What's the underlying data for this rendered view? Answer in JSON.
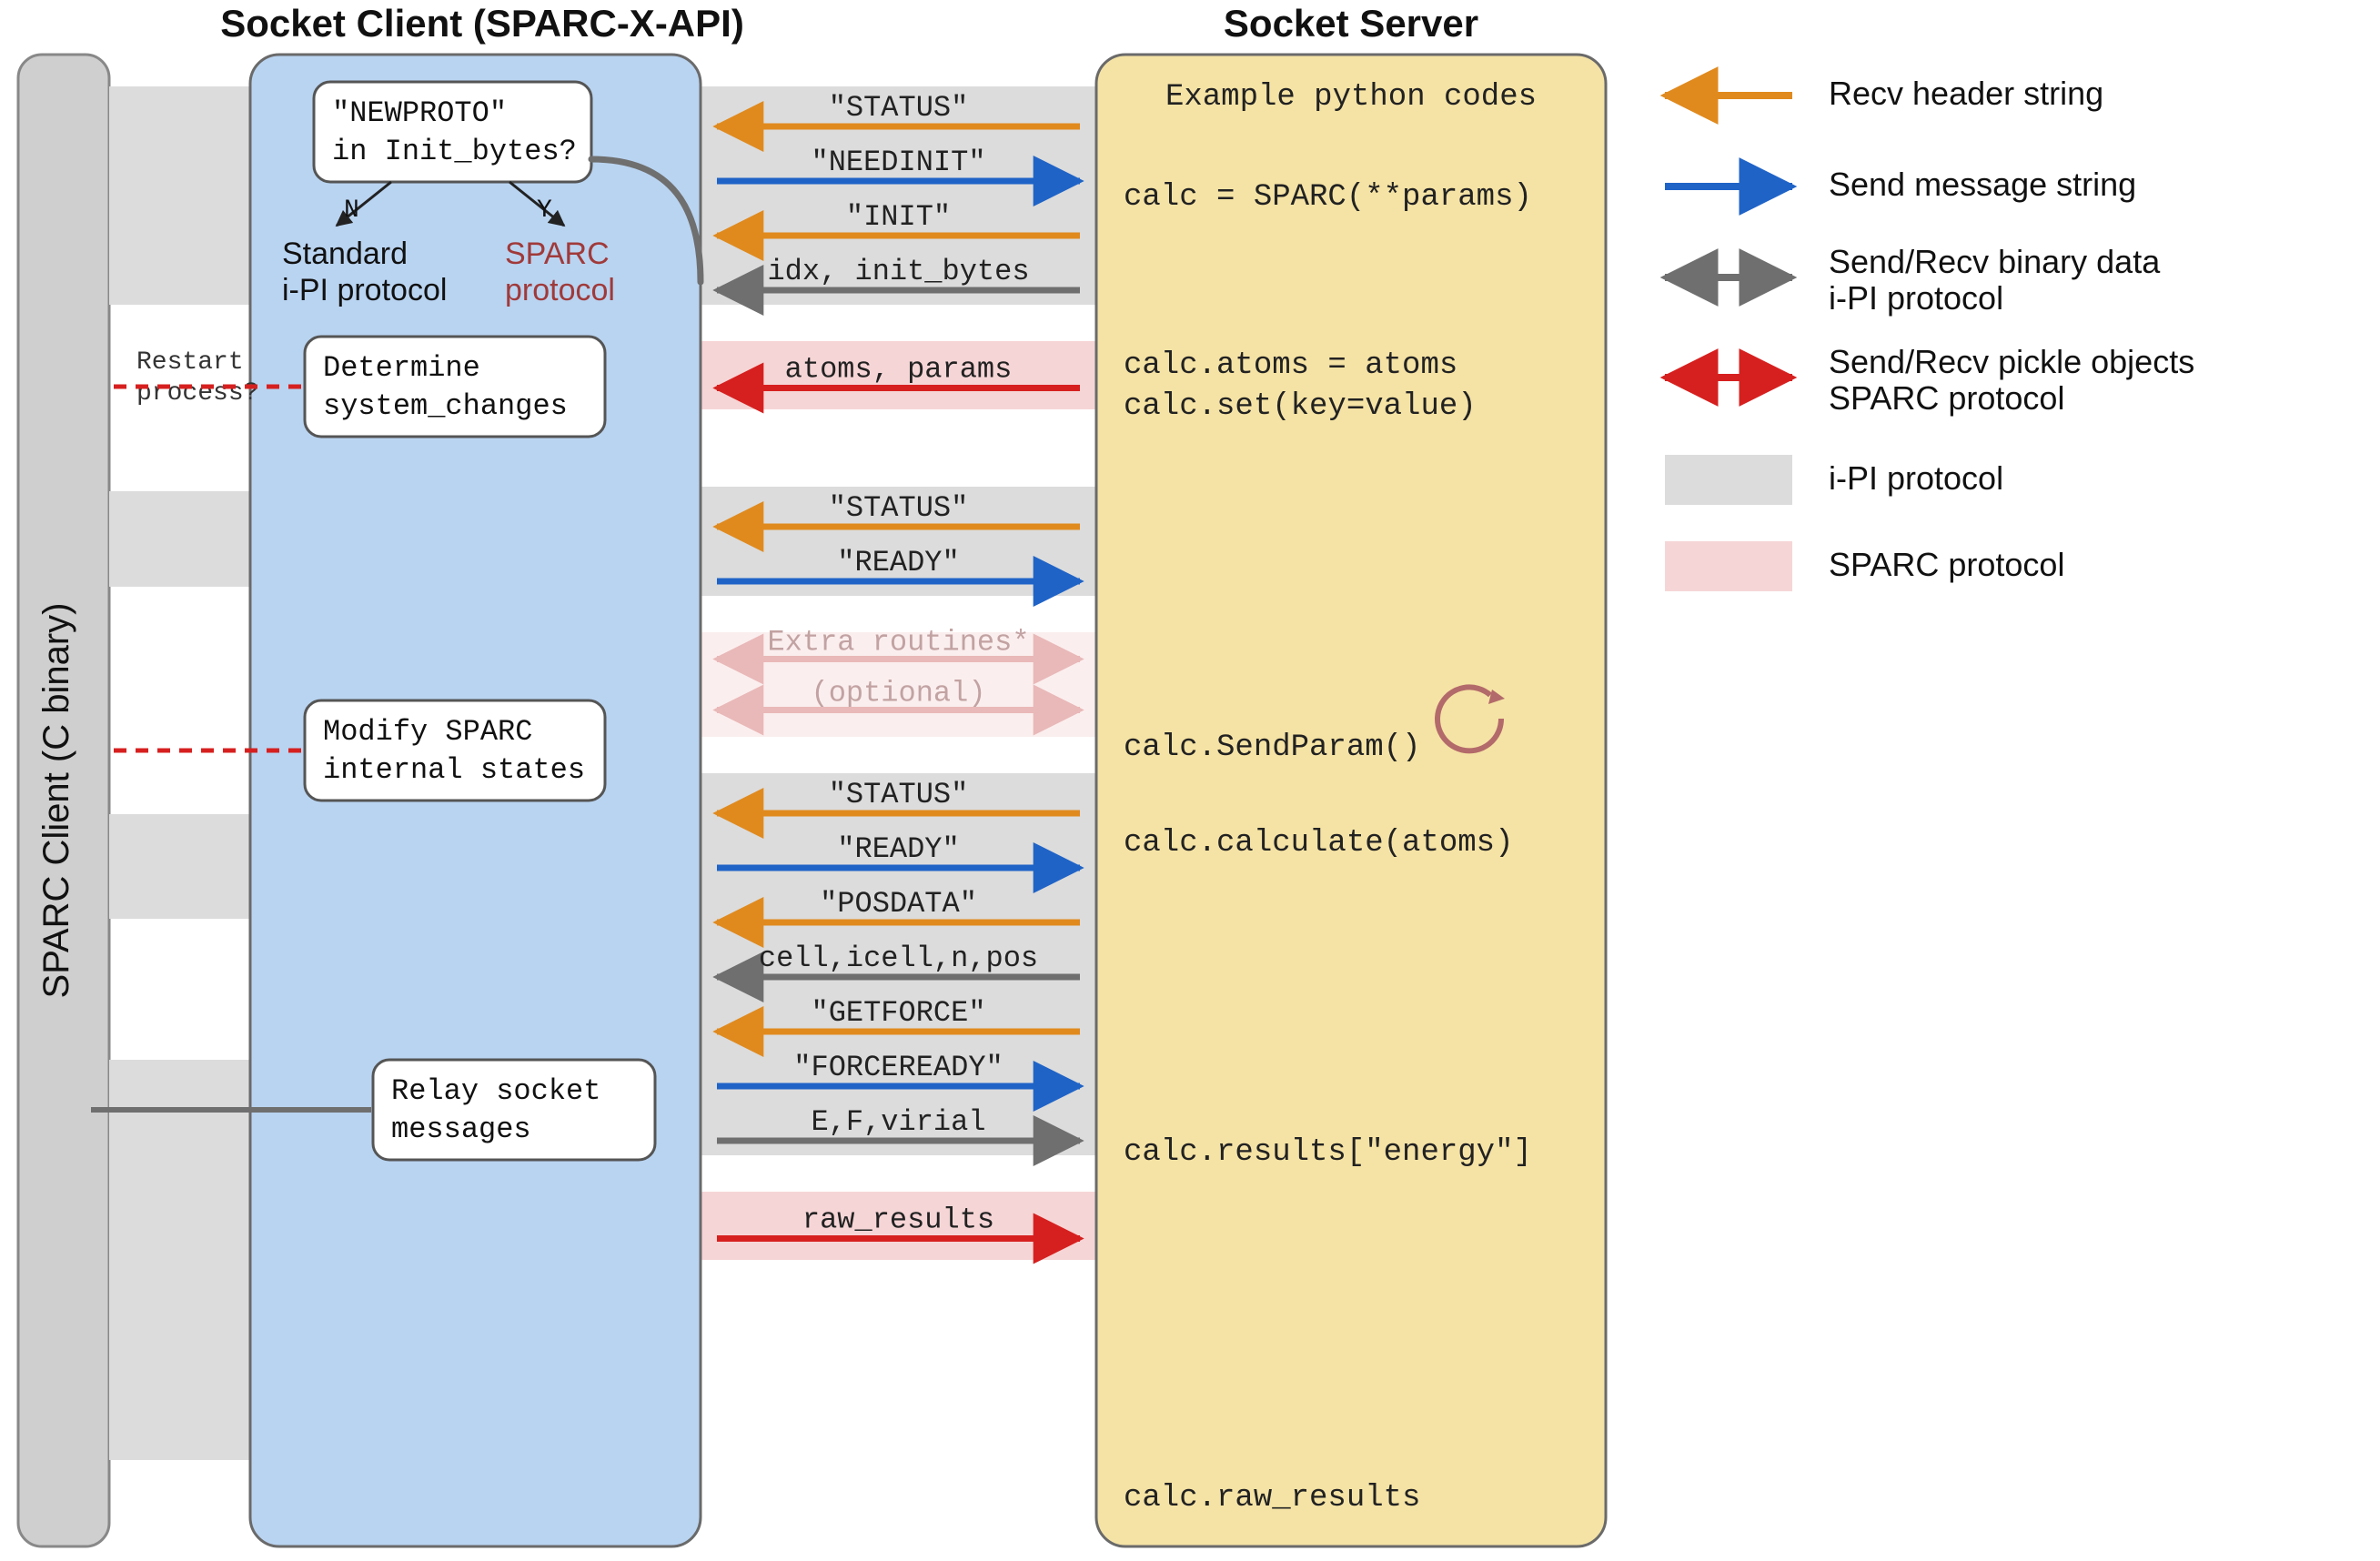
{
  "titles": {
    "client_api": "Socket Client (SPARC-X-API)",
    "server": "Socket Server",
    "client_c": "SPARC Client (C binary)"
  },
  "decision": {
    "line1": "\"NEWPROTO\"",
    "line2": "in Init_bytes?",
    "no": "N",
    "yes": "Y",
    "left_label_l1": "Standard",
    "left_label_l2": "i-PI protocol",
    "right_label_l1": "SPARC",
    "right_label_l2": "protocol"
  },
  "boxes": {
    "restart": "Restart\nprocess?",
    "determine_l1": "Determine",
    "determine_l2": "system_changes",
    "modify_l1": "Modify SPARC",
    "modify_l2": "internal states",
    "relay_l1": "Relay socket",
    "relay_l2": "messages"
  },
  "rows": [
    {
      "type": "orange",
      "label": "\"STATUS\"",
      "bg": "gray"
    },
    {
      "type": "blue",
      "label": "\"NEEDINIT\"",
      "bg": "gray"
    },
    {
      "type": "orange",
      "label": "\"INIT\"",
      "bg": "gray"
    },
    {
      "type": "gray-left",
      "label": "idx, init_bytes",
      "bg": "gray"
    },
    {
      "type": "red-left",
      "label": "atoms, params",
      "bg": "pink"
    },
    {
      "type": "orange",
      "label": "\"STATUS\"",
      "bg": "gray"
    },
    {
      "type": "blue",
      "label": "\"READY\"",
      "bg": "gray"
    },
    {
      "type": "pink-double",
      "l1": "Extra routines*",
      "l2": "(optional)",
      "bg": "pink-light"
    },
    {
      "type": "orange",
      "label": "\"STATUS\"",
      "bg": "gray"
    },
    {
      "type": "blue",
      "label": "\"READY\"",
      "bg": "gray"
    },
    {
      "type": "orange",
      "label": "\"POSDATA\"",
      "bg": "gray"
    },
    {
      "type": "gray-left",
      "label": "cell,icell,n,pos",
      "bg": "gray"
    },
    {
      "type": "orange",
      "label": "\"GETFORCE\"",
      "bg": "gray"
    },
    {
      "type": "blue",
      "label": "\"FORCEREADY\"",
      "bg": "gray"
    },
    {
      "type": "gray-right",
      "label": "E,F,virial",
      "bg": "gray"
    },
    {
      "type": "red-right",
      "label": "raw_results",
      "bg": "pink"
    }
  ],
  "server_codes": {
    "title": "Example python codes",
    "c1": "calc = SPARC(**params)",
    "c2a": "calc.atoms = atoms",
    "c2b": "calc.set(key=value)",
    "c3": "calc.SendParam()",
    "c4": "calc.calculate(atoms)",
    "c5": "calc.results[\"energy\"]",
    "c6": "calc.raw_results"
  },
  "legend": {
    "recv": "Recv header string",
    "send": "Send message string",
    "bin_l1": "Send/Recv binary data",
    "bin_l2": "i-PI protocol",
    "pkl_l1": "Send/Recv pickle objects",
    "pkl_l2": "SPARC protocol",
    "ipi": "i-PI protocol",
    "sparc": "SPARC protocol"
  },
  "colors": {
    "client_fill": "#b9d4f1",
    "client_stroke": "#6a6a6a",
    "server_fill": "#f5e3a5",
    "server_stroke": "#6a6a6a",
    "c_col_fill": "#cfcfcf",
    "c_col_stroke": "#888",
    "gray_bg": "#dcdcdc",
    "pink_bg": "#f6d5d6",
    "pink_light_bg": "#fbeeee",
    "orange": "#e08a1e",
    "blue": "#1f63c7",
    "graya": "#6f6f6f",
    "red": "#d6201f",
    "pinka": "#e9b8b8",
    "sparc_text": "#a03a3a"
  }
}
